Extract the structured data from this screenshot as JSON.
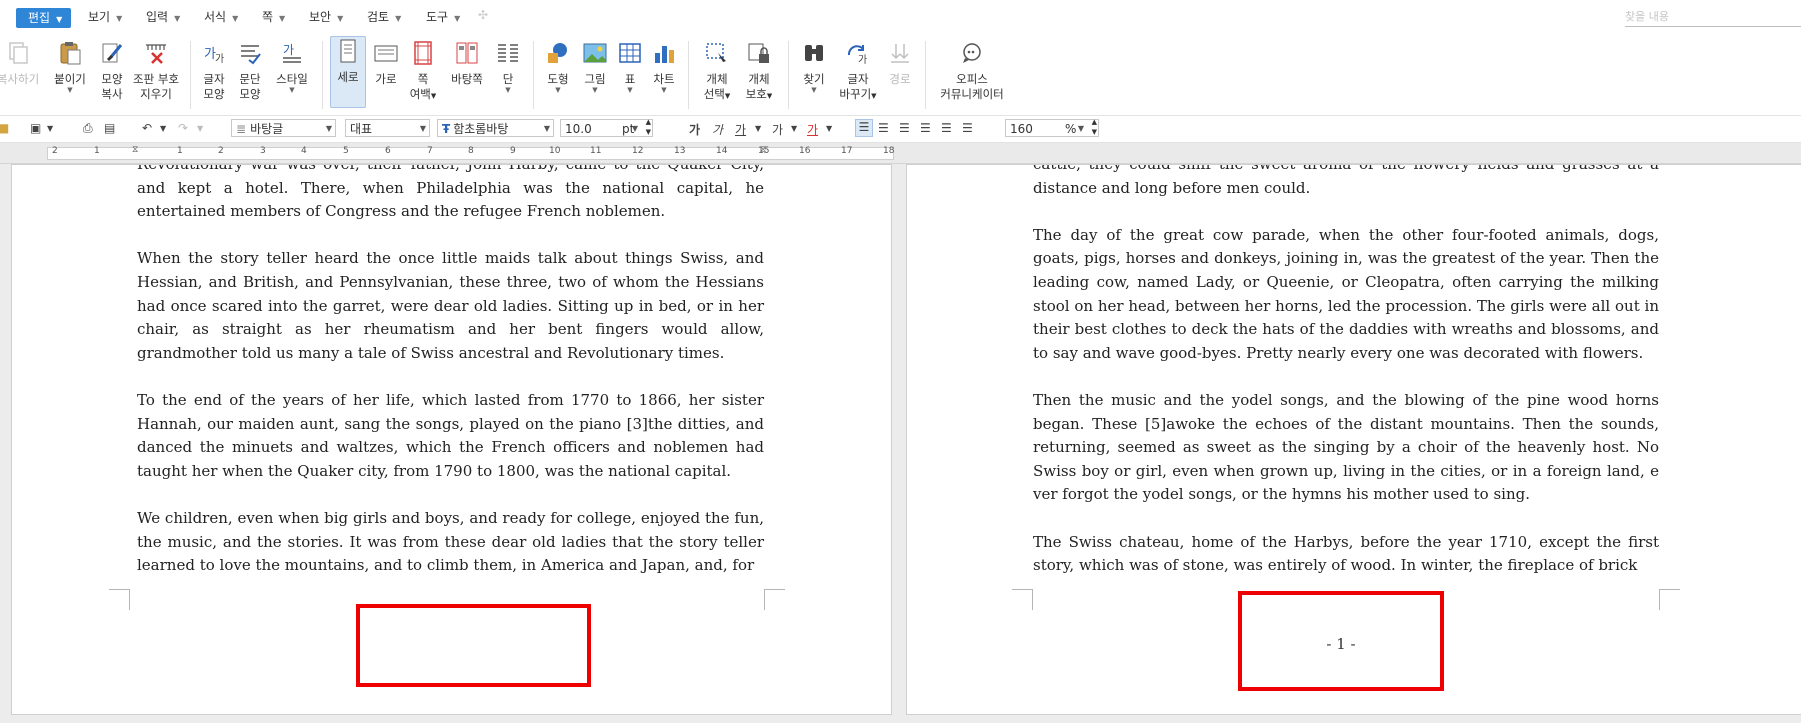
{
  "menubar": {
    "edit": "편집",
    "items": [
      "보기",
      "입력",
      "서식",
      "쪽",
      "보안",
      "검토",
      "도구"
    ],
    "search_placeholder": "찾을 내용"
  },
  "ribbon": {
    "copy_format": "복사하기",
    "paste": "붙이기",
    "shape_copy": [
      "모양",
      "복사"
    ],
    "clear_char_format": [
      "조판 부호",
      "지우기"
    ],
    "char_shape": [
      "글자",
      "모양"
    ],
    "para_shape": [
      "문단",
      "모양"
    ],
    "style": "스타일",
    "vertical": "세로",
    "horizontal": "가로",
    "page_margin": [
      "쪽",
      "여백"
    ],
    "background": "바탕쪽",
    "columns": "단",
    "shapes": "도형",
    "picture": "그림",
    "table": "표",
    "chart": "차트",
    "select_object": [
      "개체",
      "선택"
    ],
    "protect_object": [
      "개체",
      "보호"
    ],
    "find": "찾기",
    "replace": [
      "글자",
      "바꾸기"
    ],
    "path": "경로",
    "office_navigator": [
      "오피스",
      "커뮤니케이터"
    ]
  },
  "format_toolbar": {
    "style": "바탕글",
    "lang": "대표",
    "font": "함초롬바탕",
    "size": "10.0",
    "unit": "pt",
    "bold": "가",
    "italic": "가",
    "underline": "가",
    "strike": "가",
    "color": "가",
    "zoom": "160",
    "zoom_unit": "%"
  },
  "ruler": {
    "numbers": [
      "2",
      "1",
      "1",
      "2",
      "3",
      "4",
      "5",
      "6",
      "7",
      "8",
      "9",
      "10",
      "11",
      "12",
      "13",
      "14",
      "15",
      "16",
      "17",
      "18"
    ]
  },
  "left_page": {
    "paragraphs": [
      "Revolutionary war was over, their father, John Harby, came to the Quaker City, and kept a hotel. There, when Philadelphia was the national capital, he entertained members of Congress and the refugee French noblemen.",
      "When the story teller heard the once little maids talk about things Swiss, and Hessian, and British, and Pennsylvanian, these three, two of whom the Hessians had once scared into the garret, were dear old ladies. Sitting up in bed, or in her chair, as straight as her rheumatism and her bent fingers would allow, grandmother told us many a tale of Swiss ancestral and Revolutionary times.",
      "To the end of the years of her life, which lasted from 1770 to 1866, her sister Hannah, our maiden aunt, sang the songs, played on the piano [3]the ditties, and danced the minuets and waltzes, which the French officers and noblemen had taught her when the Quaker city, from 1790 to 1800, was the national capital.",
      "We children, even when big girls and boys, and ready for college, enjoyed the fun, the music, and the stories. It was from these dear old ladies that the story teller learned to love the mountains, and to climb them, in America and Japan, and, for"
    ]
  },
  "right_page": {
    "paragraphs": [
      "cattle, they could sniff the sweet aroma of the flowery fields and grasses at a distance and long before men could.",
      "The day of the great cow parade, when the other four-footed animals, dogs, goats, pigs, horses and donkeys, joining in, was the greatest of the year. Then the leading cow, named Lady, or Queenie, or Cleopatra, often carrying the milking stool on her head, between her horns, led the procession. The girls were all out in their best clothes to deck the hats of the daddies with wreaths and blossoms, and to say and wave good-byes. Pretty nearly every one was decorated with flowers.",
      "Then the music and the yodel songs, and the blowing of the pine wood horns began. These [5]awoke the echoes of the distant mountains. Then the sounds, returning, seemed as sweet as the singing by a choir of the heavenly host. No Swiss boy or girl, even when grown up, living in the cities, or in a foreign land, e ver forgot the yodel songs, or the hymns his mother used to sing.",
      "The Swiss chateau, home of the Harbys, before the year 1710, except the first story, which was of stone, was entirely of wood. In winter, the fireplace of brick"
    ],
    "page_number": "- 1 -"
  },
  "colors": {
    "accent": "#2f86d6",
    "highlight": "#ee0000"
  }
}
